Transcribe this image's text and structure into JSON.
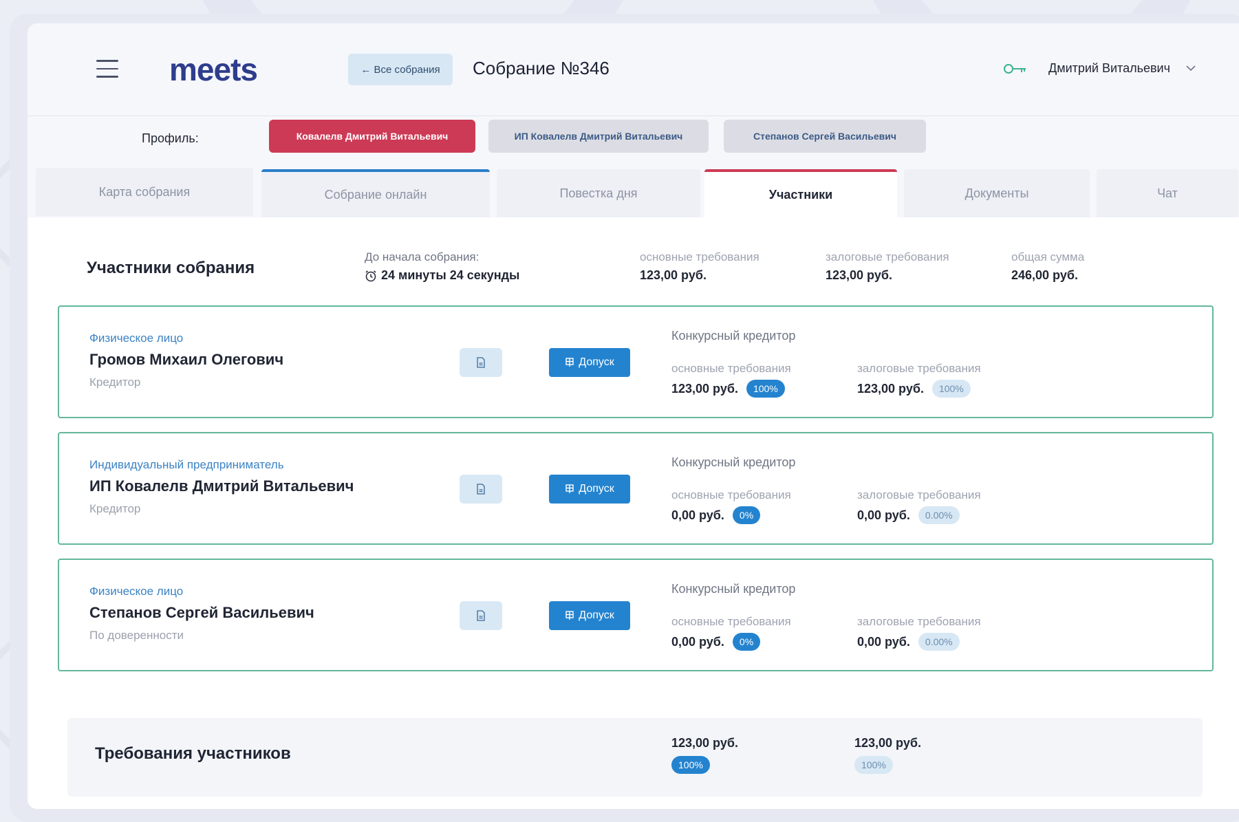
{
  "header": {
    "logo": "meets",
    "back_button": "← Все собрания",
    "meeting_title": "Собрание №346",
    "user_name": "Дмитрий Витальевич"
  },
  "profile": {
    "label": "Профиль:",
    "options": [
      "Ковалелв Дмитрий Витальевич",
      "ИП Ковалелв Дмитрий Витальевич",
      "Степанов Сергей Васильевич"
    ],
    "active_index": 0
  },
  "tabs": [
    "Карта собрания",
    "Собрание онлайн",
    "Повестка дня",
    "Участники",
    "Документы",
    "Чат"
  ],
  "active_tab_index": 3,
  "section": {
    "title": "Участники собрания",
    "timer_label": "До начала собрания:",
    "timer_value": "24 минуты 24 секунды",
    "stats": [
      {
        "label": "основные требования",
        "value": "123,00 руб."
      },
      {
        "label": "залоговые требования",
        "value": "123,00 руб."
      },
      {
        "label": "общая сумма",
        "value": "246,00 руб."
      }
    ]
  },
  "participants": [
    {
      "type": "Физическое лицо",
      "name": "Громов Михаил Олегович",
      "role": "Кредитор",
      "creditor": "Конкурсный кредитор",
      "main_label": "основные требования",
      "main_value": "123,00 руб.",
      "main_pct": "100%",
      "pledge_label": "залоговые требования",
      "pledge_value": "123,00 руб.",
      "pledge_pct": "100%",
      "admit_label": "Допуск"
    },
    {
      "type": "Индивидуальный предприниматель",
      "name": "ИП Ковалелв Дмитрий Витальевич",
      "role": "Кредитор",
      "creditor": "Конкурсный кредитор",
      "main_label": "основные требования",
      "main_value": "0,00 руб.",
      "main_pct": "0%",
      "pledge_label": "залоговые требования",
      "pledge_value": "0,00 руб.",
      "pledge_pct": "0.00%",
      "admit_label": "Допуск"
    },
    {
      "type": "Физическое лицо",
      "name": "Степанов Сергей Васильевич",
      "role": "По доверенности",
      "creditor": "Конкурсный кредитор",
      "main_label": "основные требования",
      "main_value": "0,00 руб.",
      "main_pct": "0%",
      "pledge_label": "залоговые требования",
      "pledge_value": "0,00 руб.",
      "pledge_pct": "0.00%",
      "admit_label": "Допуск"
    }
  ],
  "summary": {
    "title": "Требования участников",
    "main_value": "123,00 руб.",
    "main_pct": "100%",
    "pledge_value": "123,00 руб.",
    "pledge_pct": "100%"
  },
  "colors": {
    "accent_red": "#cd3a55",
    "accent_blue": "#2483cf",
    "card_border": "#63b799",
    "logo": "#2e3d8c"
  },
  "icons": {
    "menu": "hamburger-icon",
    "key": "key-icon",
    "chevron": "chevron-down-icon",
    "alarm": "alarm-clock-icon",
    "document": "document-icon",
    "admit": "admit-icon"
  }
}
